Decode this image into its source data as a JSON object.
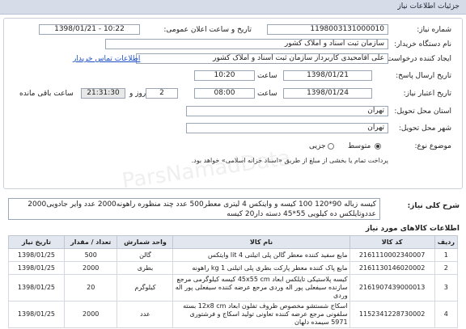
{
  "header": {
    "title": "جزئیات اطلاعات نیاز"
  },
  "fields": {
    "need_number_label": "شماره نیاز:",
    "need_number": "1198003131000010",
    "announce_label": "تاریخ و ساعت اعلان عمومی:",
    "announce_value": "1398/01/21 - 10:22",
    "buyer_org_label": "نام دستگاه خریدار:",
    "buyer_org": "سازمان ثبت اسناد و املاک کشور",
    "creator_label": "ایجاد کننده درخواست:",
    "creator": "علی آقامحیدی کاربرداز سازمان ثبت اسناد و املاک کشور",
    "contact_link": "اطلاعات تماس خریدار",
    "reply_deadline_label": "تاریخ ارسال پاسخ:",
    "reply_date": "1398/01/21",
    "reply_time_label": "ساعت",
    "reply_time": "10:20",
    "validity_label": "تاریخ اعتبار نیاز:",
    "validity_date": "1398/01/24",
    "validity_time_label": "ساعت",
    "validity_time": "08:00",
    "days": "2",
    "days_label": "روز و",
    "timer": "21:31:30",
    "timer_label": "ساعت باقی مانده",
    "province_label": "استان محل تحویل:",
    "province": "تهران",
    "city_label": "شهر محل تحویل:",
    "city": "تهران",
    "class_label": "موضوع نوع:",
    "class_opt1": "متوسط",
    "class_opt2": "جزیی",
    "class_note": "پرداخت تمام یا بخشی از مبلغ از طریق «اسناد خزانه اسلامی» خواهد بود."
  },
  "description": {
    "label": "شرح کلی نیاز:",
    "text": "کیسه زباله 90*120  100 کیسه و وایتکس 4 لیتری معطر500 عدد چند منظوره راهونه2000 عدد وایر جادویی2000 عددوتایلکس ده کیلویی 55*45 دسته دار20 کیسه"
  },
  "goods_section_title": "اطلاعات کالاهای مورد نیاز",
  "goods_table": {
    "headers": [
      "ردیف",
      "کد کالا",
      "نام کالا",
      "واحد شمارش",
      "تعداد / مقدار",
      "تاریخ نیاز"
    ],
    "rows": [
      {
        "row": "1",
        "code": "2161110002340007",
        "name": "مایع سفید کننده معطر گالن پلی اتیلنی 4 lit وایتکس",
        "unit": "گالن",
        "qty": "500",
        "date": "1398/01/25"
      },
      {
        "row": "2",
        "code": "2161130146020002",
        "name": "مایع پاک کننده معطر پارکت بطری پلی اتیلنی 1 kg راهونه",
        "unit": "بطری",
        "qty": "2000",
        "date": "1398/01/25"
      },
      {
        "row": "3",
        "code": "2161907439000013",
        "name": "کیسه پلاستیکی تایلکس ابعاد 45x55 cm کیسه کیلوگرمی مرجع سازنده سیفعلی پور اله وردی مرجع عرضه کننده سیفعلی پور اله وردی",
        "unit": "کیلوگرم",
        "qty": "20",
        "date": "1398/01/25"
      },
      {
        "row": "4",
        "code": "1152341228730002",
        "name": "اسکاج شستشو مخصوص ظروف تفلون ابعاد 12x8 cm بسته سلفونی مرجع عرضه کننده تعاونی تولید اسکاج و فرشتوری 5971 سیمده دلهان",
        "unit": "عدد",
        "qty": "2000",
        "date": "1398/01/25"
      }
    ]
  },
  "watermark": "ParsNamadData"
}
